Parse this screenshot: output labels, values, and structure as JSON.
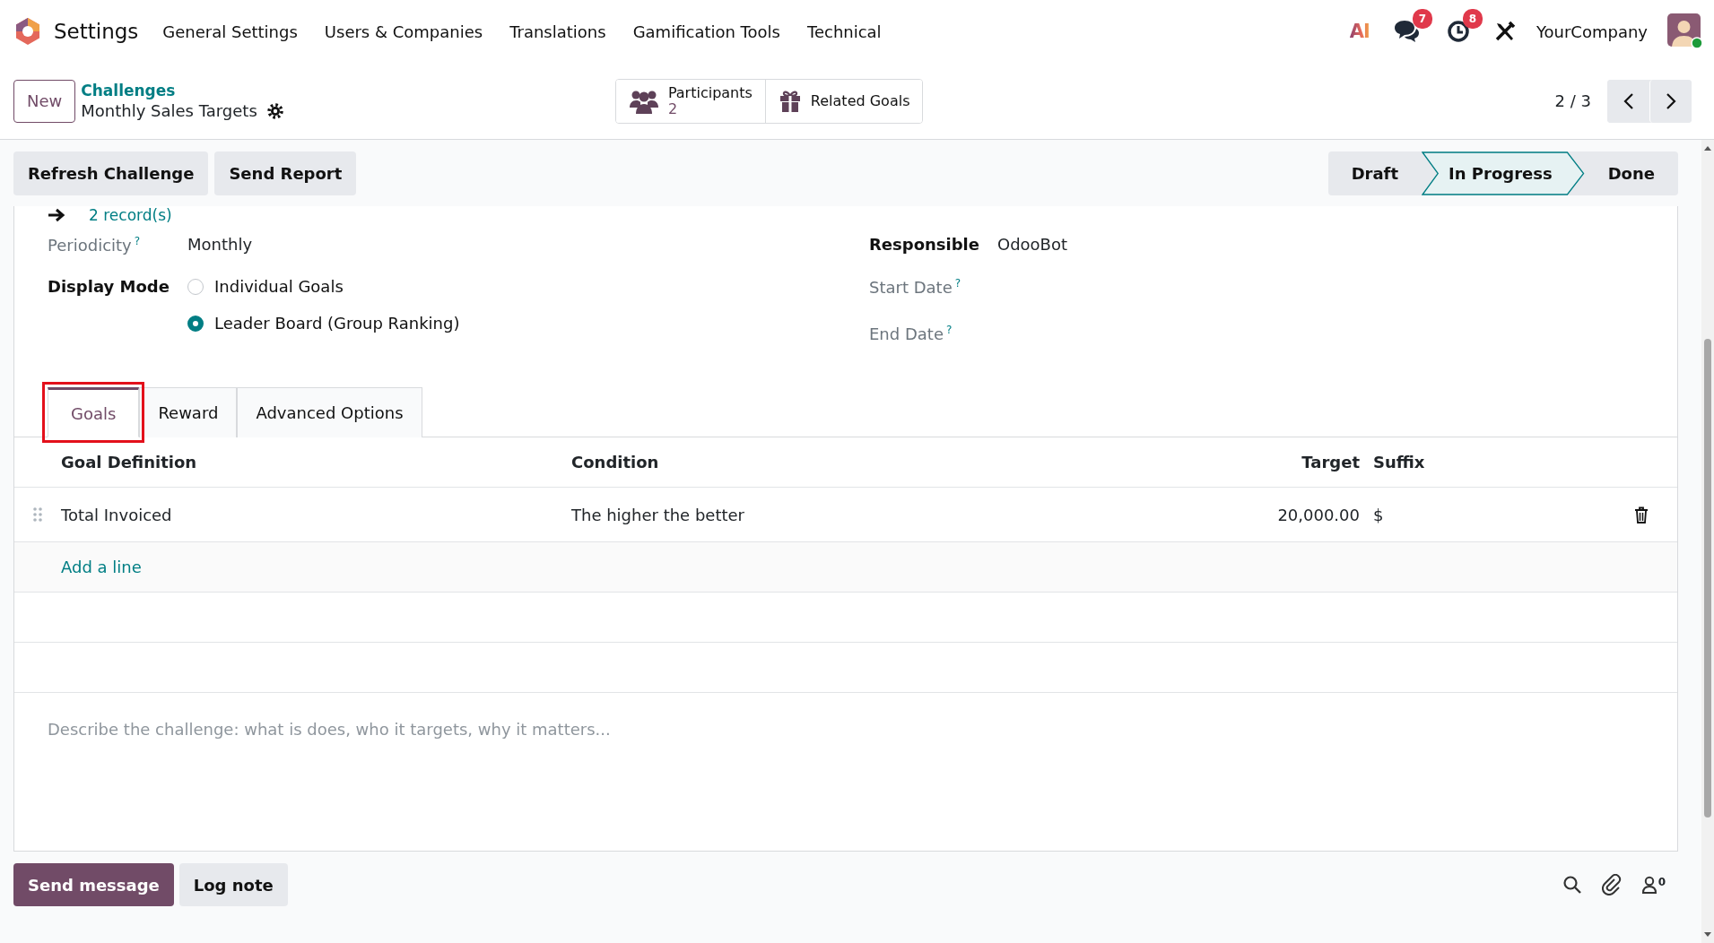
{
  "app": {
    "name": "Settings"
  },
  "menu": [
    "General Settings",
    "Users & Companies",
    "Translations",
    "Gamification Tools",
    "Technical"
  ],
  "systray": {
    "ai_label": "AI",
    "messages_count": "7",
    "activities_count": "8",
    "company": "YourCompany"
  },
  "new_button": "New",
  "breadcrumb": {
    "parent": "Challenges",
    "current": "Monthly Sales Targets"
  },
  "smart_buttons": [
    {
      "kind": "participants",
      "label": "Participants",
      "value": "2"
    },
    {
      "kind": "goals",
      "label": "Related Goals"
    }
  ],
  "pager": {
    "value": "2 / 3"
  },
  "actions": [
    "Refresh Challenge",
    "Send Report"
  ],
  "stages": [
    {
      "label": "Draft",
      "selected": false
    },
    {
      "label": "In Progress",
      "selected": true
    },
    {
      "label": "Done",
      "selected": false
    }
  ],
  "records_link": "2 record(s)",
  "left_fields": [
    {
      "kind": "text",
      "label": "Periodicity",
      "required": false,
      "help": "?",
      "value": "Monthly"
    },
    {
      "kind": "radio",
      "label": "Display Mode",
      "required": true,
      "options": [
        {
          "label": "Individual Goals",
          "selected": false
        },
        {
          "label": "Leader Board (Group Ranking)",
          "selected": true
        }
      ]
    }
  ],
  "right_fields": [
    {
      "kind": "text",
      "label": "Responsible",
      "required": true,
      "value": "OdooBot"
    },
    {
      "kind": "text",
      "label": "Start Date",
      "required": false,
      "help": "?"
    },
    {
      "kind": "text",
      "label": "End Date",
      "required": false,
      "help": "?"
    }
  ],
  "tabs": [
    {
      "label": "Goals",
      "selected": true,
      "highlighted": true
    },
    {
      "label": "Reward",
      "selected": false,
      "highlighted": false
    },
    {
      "label": "Advanced Options",
      "selected": false,
      "highlighted": false
    }
  ],
  "table": {
    "columns": [
      "Goal Definition",
      "Condition",
      "Target",
      "Suffix"
    ],
    "rows": [
      {
        "cells": [
          "Total Invoiced",
          "The higher the better",
          "20,000.00",
          "$"
        ]
      }
    ],
    "add_line": "Add a line"
  },
  "description": {
    "placeholder": "Describe the challenge: what is does, who it targets, why it matters..."
  },
  "chatter": {
    "buttons": [
      {
        "label": "Send message",
        "primary": true
      },
      {
        "label": "Log note",
        "primary": false
      }
    ],
    "followers_count": "0"
  }
}
